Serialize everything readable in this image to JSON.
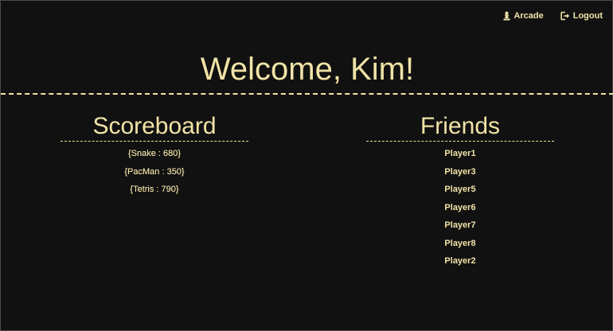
{
  "nav": {
    "arcade_label": "Arcade",
    "arcade_icon": "chess-pawn-icon",
    "logout_label": "Logout",
    "logout_icon": "logout-icon"
  },
  "header": {
    "welcome_text": "Welcome, Kim!"
  },
  "scoreboard": {
    "title": "Scoreboard",
    "entries": [
      "{Snake : 680}",
      "{PacMan : 350}",
      "{Tetris : 790}"
    ]
  },
  "friends": {
    "title": "Friends",
    "entries": [
      "Player1",
      "Player3",
      "Player5",
      "Player6",
      "Player7",
      "Player8",
      "Player2"
    ]
  },
  "colors": {
    "background": "#111111",
    "accent": "#f0e3a6"
  }
}
